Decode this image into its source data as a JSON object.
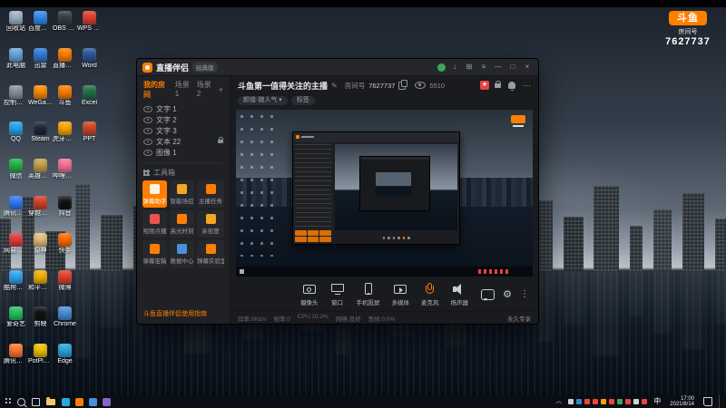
{
  "colors": {
    "accent": "#ff7e00",
    "app_bg": "#1d1e22",
    "taskbar_bg": "#0b0e13"
  },
  "overlay": {
    "logo_text": "斗鱼",
    "room_label": "房间号",
    "room_number": "7627737"
  },
  "desktop": {
    "icons": [
      {
        "label": "回收站",
        "color": "#9fb6c9"
      },
      {
        "label": "此电脑",
        "color": "#6aa7e0"
      },
      {
        "label": "控制面板",
        "color": "#8a93a0"
      },
      {
        "label": "QQ",
        "color": "#29a3ef"
      },
      {
        "label": "微信",
        "color": "#24b24a"
      },
      {
        "label": "腾讯会议",
        "color": "#2e7cf6"
      },
      {
        "label": "网易云音乐",
        "color": "#e23b3b"
      },
      {
        "label": "酷狗音乐",
        "color": "#2da8f0"
      },
      {
        "label": "爱奇艺",
        "color": "#27c45e"
      },
      {
        "label": "腾讯视频",
        "color": "#ff7a2f"
      },
      {
        "label": "百度网盘",
        "color": "#2f8cf0"
      },
      {
        "label": "迅雷",
        "color": "#2f7bd9"
      },
      {
        "label": "WeGame",
        "color": "#ff8a00"
      },
      {
        "label": "Steam",
        "color": "#1b2838"
      },
      {
        "label": "英雄联盟",
        "color": "#c8a24a"
      },
      {
        "label": "穿越火线",
        "color": "#d8402a"
      },
      {
        "label": "原神",
        "color": "#e5c07b"
      },
      {
        "label": "和平精英",
        "color": "#f2b300"
      },
      {
        "label": "剪映",
        "color": "#111111"
      },
      {
        "label": "PotPlayer",
        "color": "#f2c200"
      },
      {
        "label": "OBS Studio",
        "color": "#3a3f44"
      },
      {
        "label": "直播伴侣",
        "color": "#ff7e00"
      },
      {
        "label": "斗鱼",
        "color": "#ff7e00"
      },
      {
        "label": "虎牙直播",
        "color": "#ffa800"
      },
      {
        "label": "哔哩哔哩",
        "color": "#fb7299"
      },
      {
        "label": "抖音",
        "color": "#111111"
      },
      {
        "label": "快手",
        "color": "#ff6d00"
      },
      {
        "label": "微博",
        "color": "#e6412c"
      },
      {
        "label": "Chrome",
        "color": "#4a90d9"
      },
      {
        "label": "Edge",
        "color": "#2aa7de"
      },
      {
        "label": "WPS Office",
        "color": "#e23f2f"
      },
      {
        "label": "Word",
        "color": "#2b579a"
      },
      {
        "label": "Excel",
        "color": "#217346"
      },
      {
        "label": "PPT",
        "color": "#d24726"
      }
    ]
  },
  "app": {
    "titlebar": {
      "title": "直播伴侣",
      "badge": "经典版"
    },
    "sidebar": {
      "tabs": [
        {
          "label": "我的房间",
          "active": true
        },
        {
          "label": "场景1"
        },
        {
          "label": "场景2"
        }
      ],
      "add_label": "+",
      "sources": [
        {
          "label": "文字 1"
        },
        {
          "label": "文字 2"
        },
        {
          "label": "文字 3"
        },
        {
          "label": "文本 22",
          "locked": true
        },
        {
          "label": "图像 1"
        }
      ],
      "toolbox_title": "工具箱",
      "tools": [
        {
          "label": "弹幕助手",
          "active": true,
          "color": "#ff7e00"
        },
        {
          "label": "智能场控",
          "color": "#f5a623"
        },
        {
          "label": "主播任务",
          "color": "#ff7e00"
        },
        {
          "label": "视频点播",
          "color": "#e8554d"
        },
        {
          "label": "高光时刻",
          "color": "#ff7e00"
        },
        {
          "label": "亲密度",
          "color": "#f5a623"
        },
        {
          "label": "弹幕宝箱",
          "color": "#ff7e00"
        },
        {
          "label": "数据中心",
          "color": "#4a90d9"
        },
        {
          "label": "弹幕实验室",
          "color": "#ff7e00"
        }
      ],
      "footer_link": "斗鱼直播伴侣使用指南"
    },
    "header": {
      "title": "斗鱼第一值得关注的主播",
      "room_label": "房间号",
      "room_number": "7627737",
      "viewers": "5510",
      "category": "颜值·随人气 ▾",
      "tag_label": "标签"
    },
    "toolbar": {
      "buttons": [
        {
          "label": "摄像头",
          "icon": "camera"
        },
        {
          "label": "窗口",
          "icon": "window"
        },
        {
          "label": "手机投屏",
          "icon": "phone"
        },
        {
          "label": "多媒体",
          "icon": "media"
        },
        {
          "label": "麦克风",
          "icon": "mic",
          "accent": true
        },
        {
          "label": "扬声器",
          "icon": "speaker"
        }
      ]
    },
    "statusbar": {
      "items": [
        "码率:0Kb/s",
        "帧率:0",
        "CPU:10.2%",
        "网络:良好",
        "丢帧:0.0%"
      ],
      "right": "永久专享"
    }
  },
  "taskbar": {
    "app_icons": [
      "#2aa7de",
      "#ff7e00",
      "#4a90d9",
      "#8a62c9"
    ],
    "tray_icons": [
      "#c9cdd3",
      "#3b82d0",
      "#e8433f",
      "#e8433f",
      "#f59e0b",
      "#e8433f",
      "#3ba55d",
      "#e8433f",
      "#cfd3d8",
      "#e8433f"
    ],
    "input_indicator": "中",
    "time": "17:00",
    "date": "2021/8/14"
  }
}
